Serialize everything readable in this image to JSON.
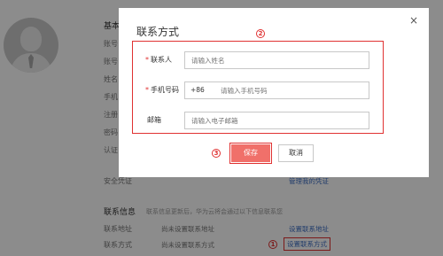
{
  "background": {
    "section_basic": "基本",
    "labels": [
      "账号",
      "账号",
      "姓名",
      "手机",
      "注册",
      "密码",
      "认证"
    ],
    "security_label": "安全凭证",
    "security_link": "管理我的凭证",
    "contact_section": "联系信息",
    "contact_desc": "联系信息更新后，华为云将会通过以下信息联系您",
    "rows": [
      {
        "label": "联系地址",
        "value": "尚未设置联系地址",
        "link": "设置联系地址"
      },
      {
        "label": "联系方式",
        "value": "尚未设置联系方式",
        "link": "设置联系方式"
      }
    ],
    "badge_1": "1"
  },
  "modal": {
    "title": "联系方式",
    "close_glyph": "×",
    "badge_2": "2",
    "badge_3": "3",
    "fields": {
      "contact_label": "联系人",
      "contact_placeholder": "请输入姓名",
      "phone_label": "手机号码",
      "phone_prefix": "+86",
      "phone_placeholder": "请输入手机号码",
      "email_label": "邮箱",
      "email_placeholder": "请输入电子邮箱"
    },
    "required_mark": "*",
    "save_label": "保存",
    "cancel_label": "取消"
  },
  "colors": {
    "annotation_red": "#e03131",
    "primary_button": "#f0706a",
    "link_blue": "#3f6fc4"
  }
}
